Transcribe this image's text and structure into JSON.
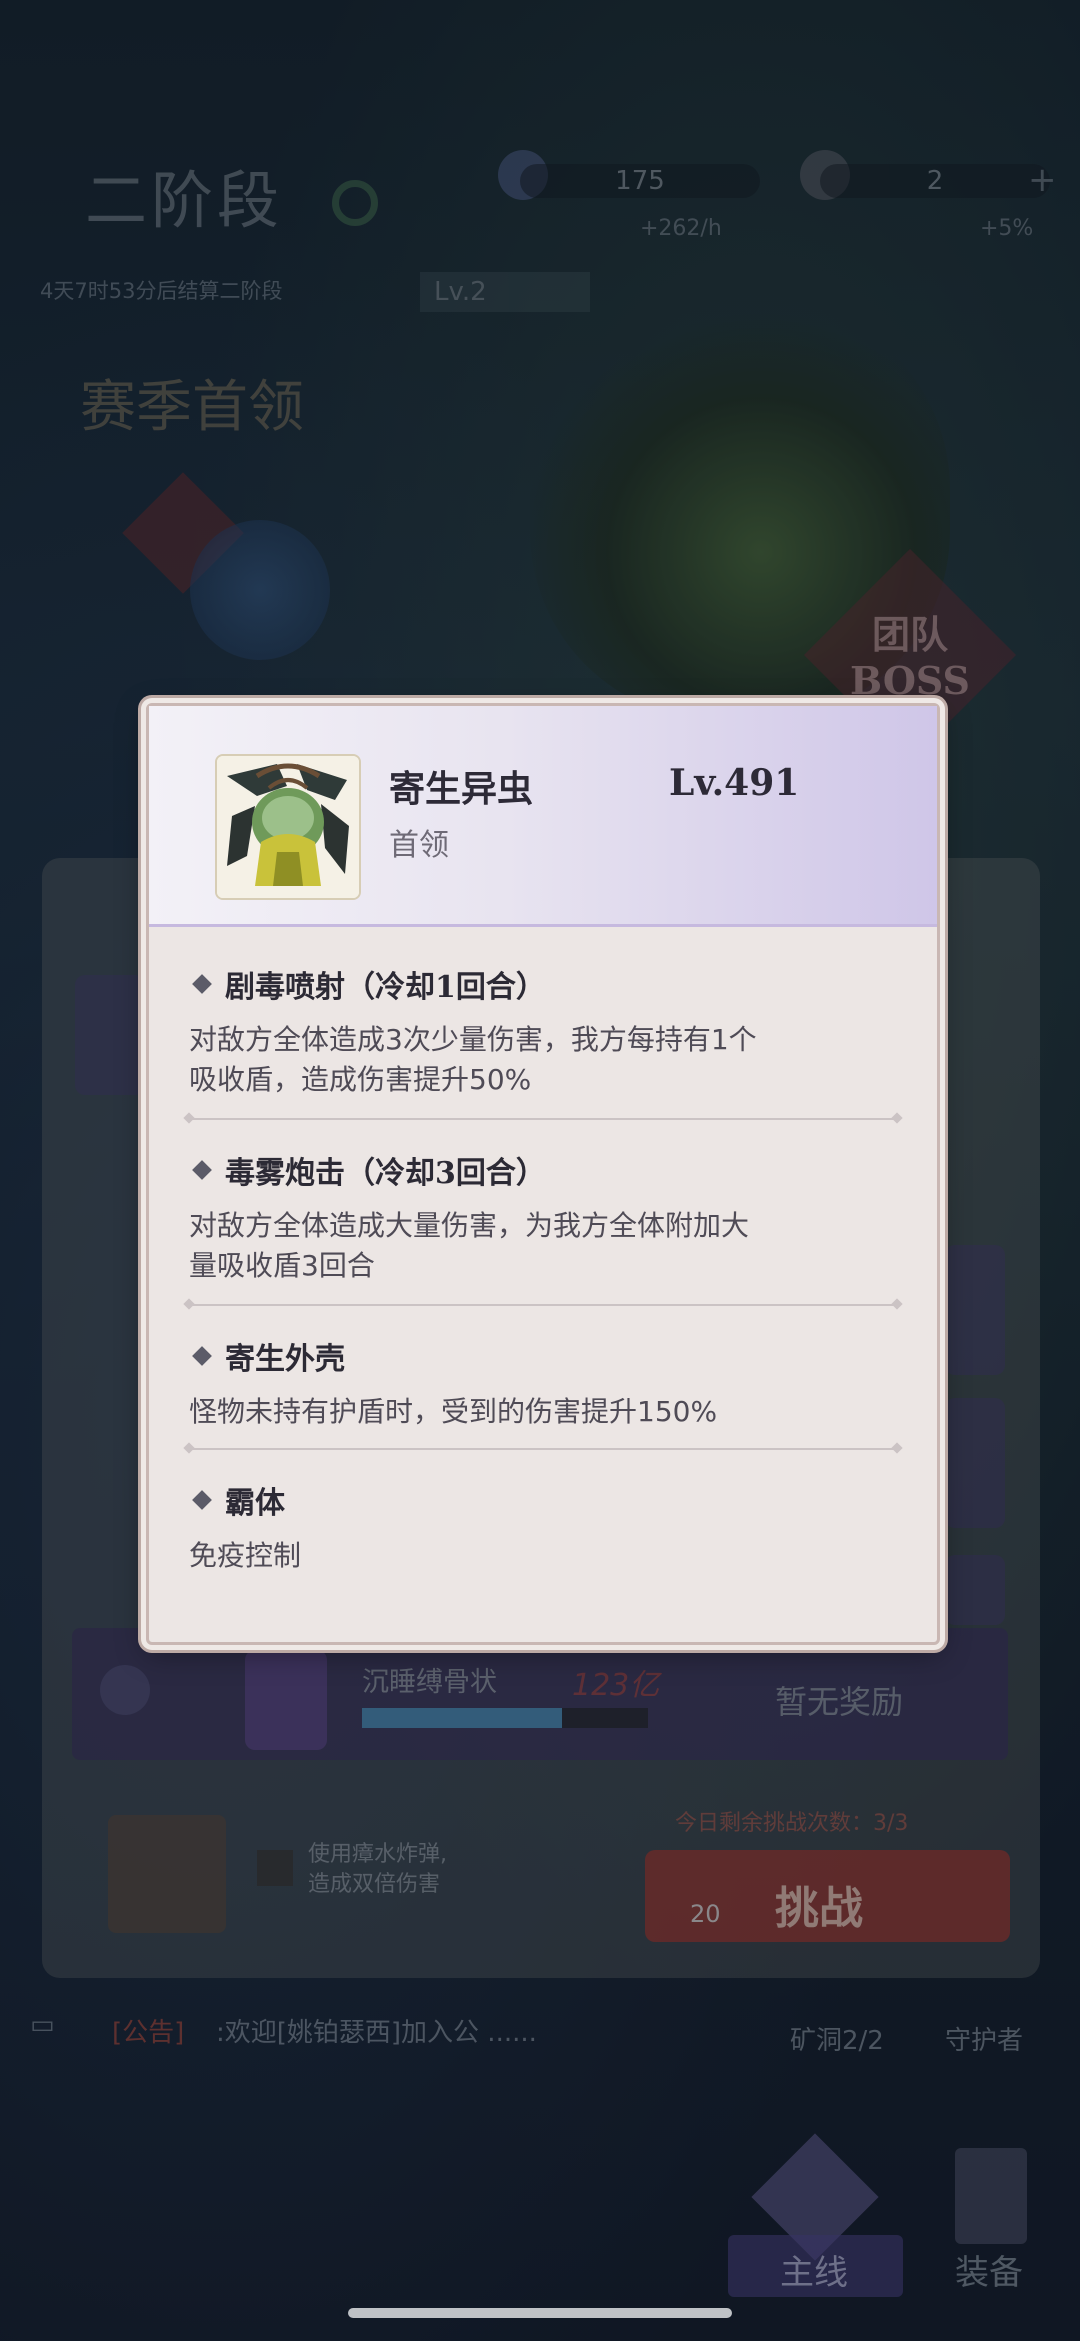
{
  "background": {
    "stage_title": "二阶段",
    "resource_1_value": "175",
    "resource_1_rate": "+262/h",
    "resource_2_value": "2",
    "resource_2_rate": "+5%",
    "countdown": "4天7时53分后结算二阶段",
    "level_chip": "Lv.2",
    "season_title": "赛季首领",
    "team_boss_label": "团队BOSS",
    "reward_label": "沉睡缚骨状",
    "reward_value": "123亿",
    "reward_progress": 0.7,
    "no_reward": "暂无奖励",
    "attempts_left": "今日剩余挑战次数：3/3",
    "challenge_label": "挑战",
    "challenge_cost": "20",
    "item_text_line1": "使用瘴水炸弹,",
    "item_text_line2": "造成双倍伤害",
    "chat_tag": "[公告]",
    "chat_text": ":欢迎[姚铂瑟西]加入公 ......",
    "mine_status": "矿洞2/2",
    "guardian": "守护者",
    "nav_main": "主线",
    "nav_equip": "装备"
  },
  "modal": {
    "boss_name": "寄生异虫",
    "boss_level": "Lv.491",
    "boss_rank": "首领",
    "skills": [
      {
        "name": "剧毒喷射（冷却1回合）",
        "desc_line1": "对敌方全体造成3次少量伤害，我方每持有1个",
        "desc_line2": "吸收盾，造成伤害提升50%"
      },
      {
        "name": "毒雾炮击（冷却3回合）",
        "desc_line1": "对敌方全体造成大量伤害，为我方全体附加大",
        "desc_line2": "量吸收盾3回合"
      },
      {
        "name": "寄生外壳",
        "desc_line1": "怪物未持有护盾时，受到的伤害提升150%"
      },
      {
        "name": "霸体",
        "desc_line1": "免疫控制"
      }
    ]
  }
}
